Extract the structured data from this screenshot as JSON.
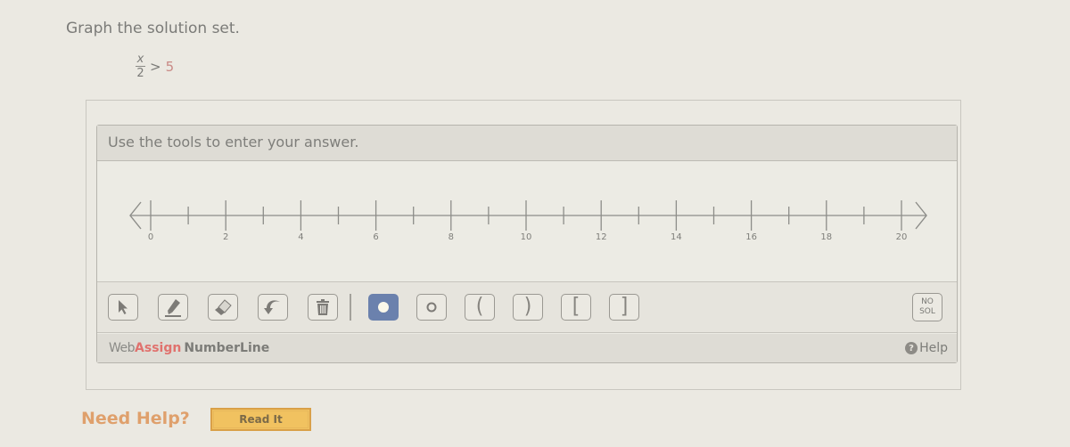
{
  "question": {
    "title": "Graph the solution set.",
    "inequality": {
      "numerator": "x",
      "denominator": "2",
      "operator": ">",
      "rhs": "5"
    }
  },
  "widget": {
    "instruction": "Use the tools to enter your answer.",
    "number_line": {
      "min_tick": 0,
      "max_tick": 20,
      "minor_step": 1,
      "labels": [
        "0",
        "2",
        "4",
        "6",
        "8",
        "10",
        "12",
        "14",
        "16",
        "18",
        "20"
      ],
      "left_arrow": "arrow-left",
      "right_arrow": "arrow-right"
    },
    "toolbar": {
      "tools": [
        {
          "name": "pointer-tool",
          "icon": "cursor-arrow-icon"
        },
        {
          "name": "pencil-tool",
          "icon": "pencil-icon"
        },
        {
          "name": "eraser-tool",
          "icon": "eraser-icon"
        },
        {
          "name": "undo-tool",
          "icon": "undo-icon"
        },
        {
          "name": "trash-tool",
          "icon": "trash-icon"
        }
      ],
      "endpoints": [
        {
          "name": "closed-dot-tool",
          "icon": "filled-circle-icon",
          "active": true
        },
        {
          "name": "open-dot-tool",
          "icon": "open-circle-icon",
          "active": false
        },
        {
          "name": "open-left-paren-tool",
          "glyph": "(",
          "active": false
        },
        {
          "name": "open-right-paren-tool",
          "glyph": ")",
          "active": false
        },
        {
          "name": "closed-left-bracket-tool",
          "glyph": "[",
          "active": false
        },
        {
          "name": "closed-right-bracket-tool",
          "glyph": "]",
          "active": false
        }
      ],
      "no_solution": {
        "line1": "NO",
        "line2": "SOL"
      },
      "active_color": "#6b81ad"
    },
    "footer": {
      "brand_web": "Web",
      "brand_assign": "Assign",
      "brand_product": "NumberLine",
      "help_label": "Help"
    }
  },
  "need_help": {
    "label": "Need Help?",
    "read_it": "Read It"
  }
}
